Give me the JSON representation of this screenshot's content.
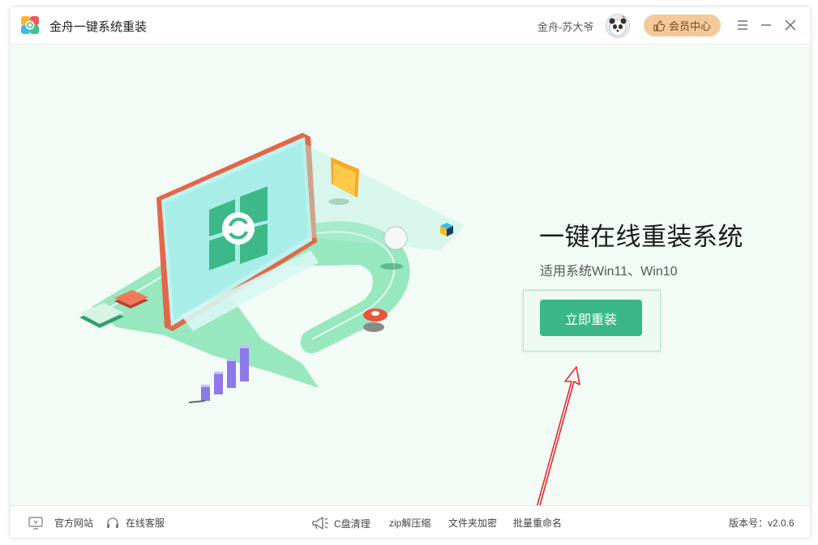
{
  "header": {
    "app_title": "金舟一键系统重装",
    "user_name": "金舟-苏大爷",
    "vip_label": "会员中心"
  },
  "main": {
    "title": "一键在线重装系统",
    "subtitle": "适用系统Win11、Win10",
    "install_button": "立即重装"
  },
  "footer": {
    "official_site": "官方网站",
    "online_service": "在线客服",
    "c_clean": "C盘清理",
    "zip": "zip解压缩",
    "folder_encrypt": "文件夹加密",
    "batch_rename": "批量重命名",
    "version": "版本号：v2.0.6"
  },
  "colors": {
    "accent": "#39b78a",
    "vip": "#f3c99a",
    "background": "#f2fbf6",
    "annotation_arrow": "#e02d2d"
  },
  "icons": [
    "app-logo-icon",
    "panda-avatar",
    "thumb-up-icon",
    "menu-icon",
    "minimize-icon",
    "close-icon",
    "website-icon",
    "headset-icon",
    "megaphone-icon"
  ]
}
